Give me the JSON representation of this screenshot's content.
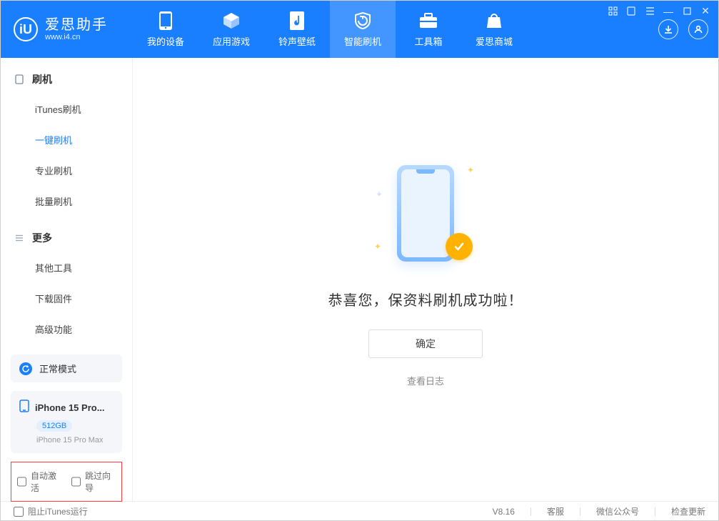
{
  "app": {
    "title": "爱思助手",
    "subtitle": "www.i4.cn",
    "version": "V8.16"
  },
  "nav": {
    "items": [
      {
        "label": "我的设备",
        "icon": "phone"
      },
      {
        "label": "应用游戏",
        "icon": "cube"
      },
      {
        "label": "铃声壁纸",
        "icon": "music"
      },
      {
        "label": "智能刷机",
        "icon": "shield",
        "active": true
      },
      {
        "label": "工具箱",
        "icon": "toolbox"
      },
      {
        "label": "爱思商城",
        "icon": "bag"
      }
    ]
  },
  "sidebar": {
    "groups": [
      {
        "title": "刷机",
        "items": [
          {
            "label": "iTunes刷机"
          },
          {
            "label": "一键刷机",
            "active": true
          },
          {
            "label": "专业刷机"
          },
          {
            "label": "批量刷机"
          }
        ]
      },
      {
        "title": "更多",
        "items": [
          {
            "label": "其他工具"
          },
          {
            "label": "下载固件"
          },
          {
            "label": "高级功能"
          }
        ]
      }
    ],
    "mode": {
      "label": "正常模式"
    },
    "device": {
      "name_truncated": "iPhone 15 Pro...",
      "storage": "512GB",
      "full_name": "iPhone 15 Pro Max"
    },
    "checkboxes": {
      "auto_activate": "自动激活",
      "skip_guide": "跳过向导"
    }
  },
  "main": {
    "success_title": "恭喜您，保资料刷机成功啦！",
    "ok_button": "确定",
    "view_log": "查看日志"
  },
  "footer": {
    "block_itunes": "阻止iTunes运行",
    "links": {
      "support": "客服",
      "wechat": "微信公众号",
      "update": "检查更新"
    }
  }
}
